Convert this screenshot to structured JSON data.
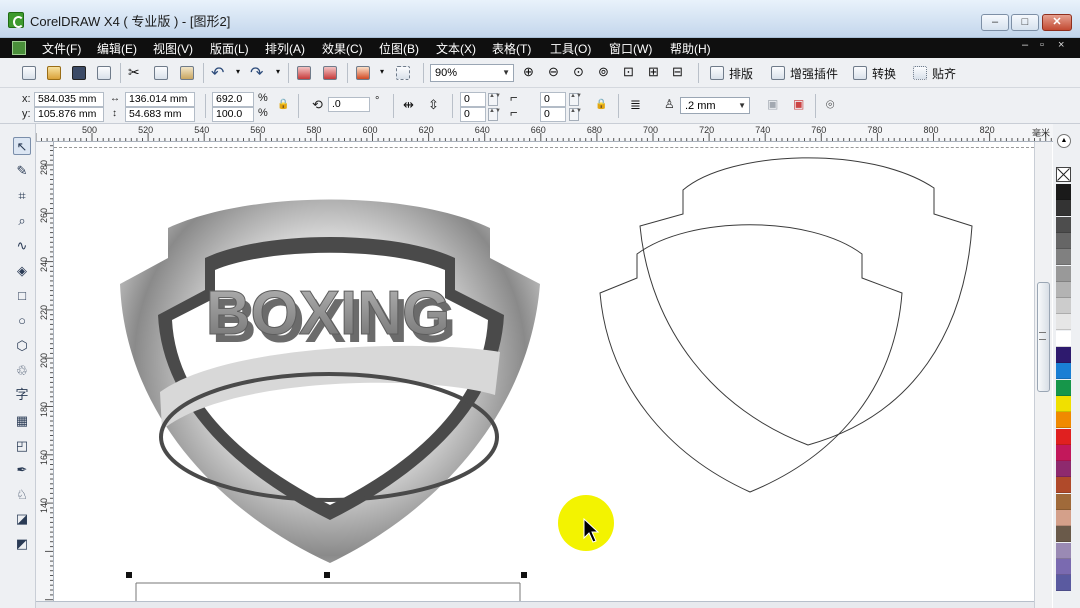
{
  "window": {
    "title": "CorelDRAW X4 ( 专业版 ) - [图形2]",
    "controls": [
      "–",
      "□",
      "✕"
    ]
  },
  "menu": {
    "items": [
      "文件(F)",
      "编辑(E)",
      "视图(V)",
      "版面(L)",
      "排列(A)",
      "效果(C)",
      "位图(B)",
      "文本(X)",
      "表格(T)",
      "工具(O)",
      "窗口(W)",
      "帮助(H)"
    ],
    "mdi_controls": [
      "–",
      "▫",
      "×"
    ]
  },
  "toolbar": {
    "zoom_value": "90%",
    "buttons": {
      "layout": "排版",
      "enhance_plugin": "增强插件",
      "convert": "转换",
      "snap": "贴齐"
    }
  },
  "property_bar": {
    "x_label": "x:",
    "x_value": "584.035 mm",
    "y_label": "y:",
    "y_value": "105.876 mm",
    "width_value": "136.014 mm",
    "height_value": "54.683 mm",
    "scale_x": "692.0",
    "scale_y": "100.0",
    "percent": "%",
    "rotation": ".0",
    "degree": "°",
    "corner_values": [
      "0",
      "0",
      "0",
      "0"
    ],
    "outline_width": ".2 mm"
  },
  "ruler": {
    "top_ticks": [
      "500",
      "520",
      "540",
      "560",
      "580",
      "600",
      "620",
      "640",
      "660",
      "680",
      "700",
      "720",
      "740",
      "760",
      "780",
      "800",
      "820"
    ],
    "left_ticks": [
      "280",
      "260",
      "240",
      "220",
      "200",
      "180",
      "160",
      "140"
    ],
    "units": "毫米"
  },
  "canvas": {
    "emblem_text": "BOXING"
  },
  "palette": {
    "colors": [
      "#1a1a1a",
      "#333333",
      "#4d4d4d",
      "#666666",
      "#808080",
      "#999999",
      "#b3b3b3",
      "#cccccc",
      "#e6e6e6",
      "#ffffff",
      "#2e1a6e",
      "#1a7fd4",
      "#16964a",
      "#f0e000",
      "#f08a00",
      "#e02020",
      "#c2185b",
      "#8e2a6e",
      "#b04a2a",
      "#a06a3a",
      "#d4a08a",
      "#6a5a4a",
      "#9a8ab4",
      "#7a6ab0",
      "#5a5aa0"
    ]
  }
}
